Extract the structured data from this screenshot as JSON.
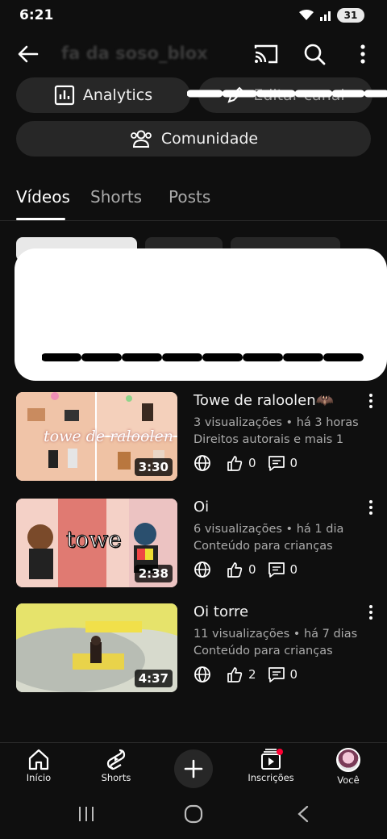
{
  "status": {
    "time": "6:21",
    "battery": "31"
  },
  "header": {
    "channel_name": "fa da soso_blox"
  },
  "actions": {
    "analytics": "Analytics",
    "edit_channel": "Editar canal",
    "community": "Comunidade"
  },
  "tabs": [
    {
      "label": "Vídeos",
      "active": true
    },
    {
      "label": "Shorts",
      "active": false
    },
    {
      "label": "Posts",
      "active": false
    }
  ],
  "videos": [
    {
      "title": "Towe de raloolen🦇",
      "meta1": "3 visualizações • há 3 horas",
      "meta2": "Direitos autorais e mais 1",
      "likes": "0",
      "comments": "0",
      "duration": "3:30",
      "thumb_text": "towe de raloolen"
    },
    {
      "title": "Oi",
      "meta1": "6 visualizações • há 1 dia",
      "meta2": "Conteúdo para crianças",
      "likes": "0",
      "comments": "0",
      "duration": "2:38",
      "thumb_text": "towe"
    },
    {
      "title": "Oi torre",
      "meta1": "11 visualizações • há 7 dias",
      "meta2": "Conteúdo para crianças",
      "likes": "2",
      "comments": "0",
      "duration": "4:37",
      "thumb_text": ""
    }
  ],
  "bottom_nav": {
    "home": "Início",
    "shorts": "Shorts",
    "subscriptions": "Inscrições",
    "you": "Você"
  },
  "colors": {
    "background": "#0f0f0f",
    "surface": "#272727",
    "text": "#f1f1f1",
    "muted": "#aaaaaa",
    "accent_red": "#ff0033"
  }
}
